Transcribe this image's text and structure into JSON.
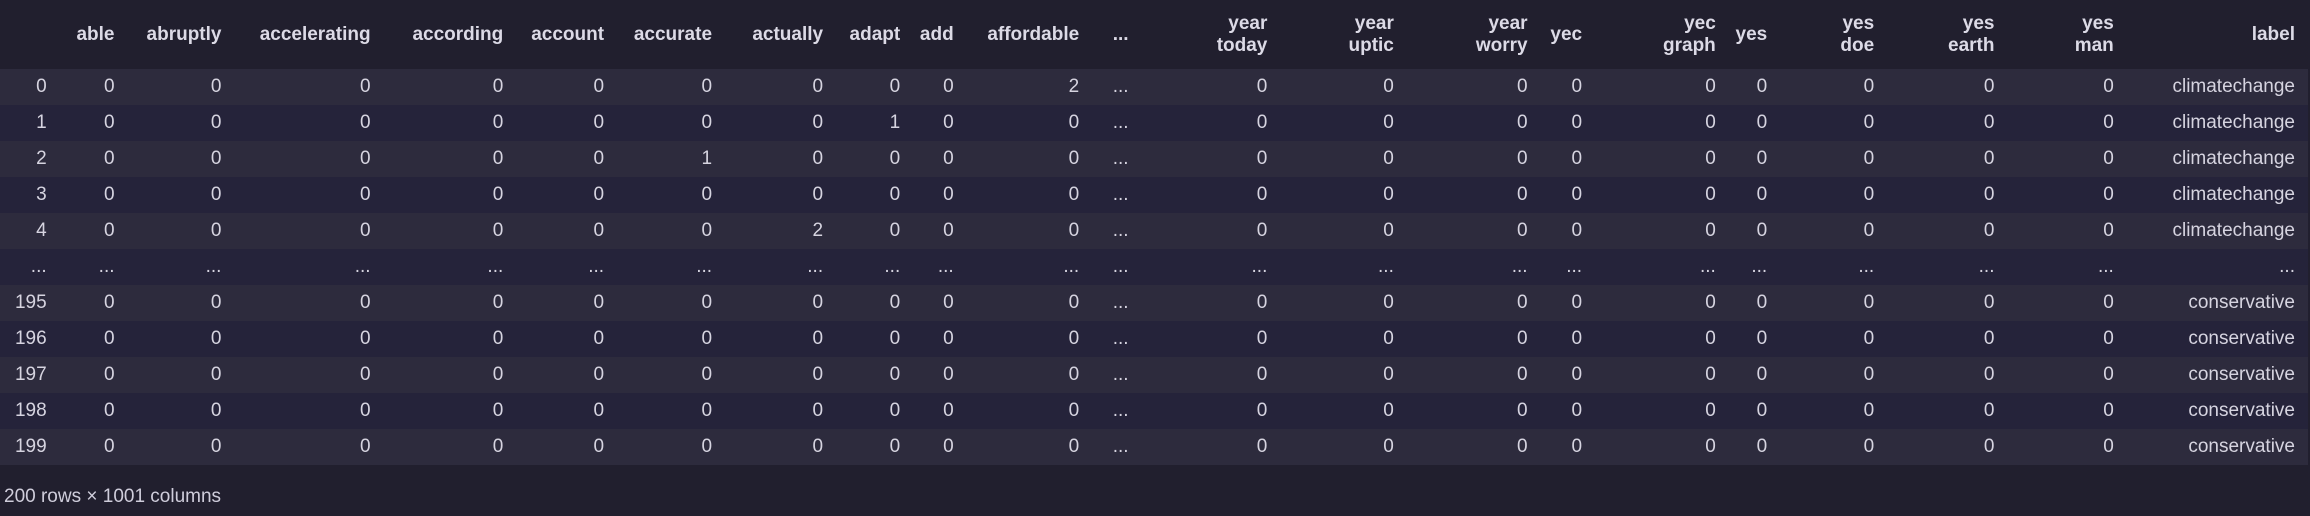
{
  "table": {
    "columns": [
      "",
      "able",
      "abruptly",
      "accelerating",
      "according",
      "account",
      "accurate",
      "actually",
      "adapt",
      "add",
      "affordable",
      "...",
      "year\ntoday",
      "year\nuptic",
      "year\nworry",
      "yec",
      "yec\ngraph",
      "yes",
      "yes\ndoe",
      "yes\nearth",
      "yes\nman",
      "label"
    ],
    "rows": [
      [
        "0",
        "0",
        "0",
        "0",
        "0",
        "0",
        "0",
        "0",
        "0",
        "0",
        "2",
        "...",
        "0",
        "0",
        "0",
        "0",
        "0",
        "0",
        "0",
        "0",
        "0",
        "climatechange"
      ],
      [
        "1",
        "0",
        "0",
        "0",
        "0",
        "0",
        "0",
        "0",
        "1",
        "0",
        "0",
        "...",
        "0",
        "0",
        "0",
        "0",
        "0",
        "0",
        "0",
        "0",
        "0",
        "climatechange"
      ],
      [
        "2",
        "0",
        "0",
        "0",
        "0",
        "0",
        "1",
        "0",
        "0",
        "0",
        "0",
        "...",
        "0",
        "0",
        "0",
        "0",
        "0",
        "0",
        "0",
        "0",
        "0",
        "climatechange"
      ],
      [
        "3",
        "0",
        "0",
        "0",
        "0",
        "0",
        "0",
        "0",
        "0",
        "0",
        "0",
        "...",
        "0",
        "0",
        "0",
        "0",
        "0",
        "0",
        "0",
        "0",
        "0",
        "climatechange"
      ],
      [
        "4",
        "0",
        "0",
        "0",
        "0",
        "0",
        "0",
        "2",
        "0",
        "0",
        "0",
        "...",
        "0",
        "0",
        "0",
        "0",
        "0",
        "0",
        "0",
        "0",
        "0",
        "climatechange"
      ],
      [
        "...",
        "...",
        "...",
        "...",
        "...",
        "...",
        "...",
        "...",
        "...",
        "...",
        "...",
        "...",
        "...",
        "...",
        "...",
        "...",
        "...",
        "...",
        "...",
        "...",
        "...",
        "..."
      ],
      [
        "195",
        "0",
        "0",
        "0",
        "0",
        "0",
        "0",
        "0",
        "0",
        "0",
        "0",
        "...",
        "0",
        "0",
        "0",
        "0",
        "0",
        "0",
        "0",
        "0",
        "0",
        "conservative"
      ],
      [
        "196",
        "0",
        "0",
        "0",
        "0",
        "0",
        "0",
        "0",
        "0",
        "0",
        "0",
        "...",
        "0",
        "0",
        "0",
        "0",
        "0",
        "0",
        "0",
        "0",
        "0",
        "conservative"
      ],
      [
        "197",
        "0",
        "0",
        "0",
        "0",
        "0",
        "0",
        "0",
        "0",
        "0",
        "0",
        "...",
        "0",
        "0",
        "0",
        "0",
        "0",
        "0",
        "0",
        "0",
        "0",
        "conservative"
      ],
      [
        "198",
        "0",
        "0",
        "0",
        "0",
        "0",
        "0",
        "0",
        "0",
        "0",
        "0",
        "...",
        "0",
        "0",
        "0",
        "0",
        "0",
        "0",
        "0",
        "0",
        "0",
        "conservative"
      ],
      [
        "199",
        "0",
        "0",
        "0",
        "0",
        "0",
        "0",
        "0",
        "0",
        "0",
        "0",
        "...",
        "0",
        "0",
        "0",
        "0",
        "0",
        "0",
        "0",
        "0",
        "0",
        "conservative"
      ]
    ]
  },
  "footer": {
    "shape_text": "200 rows × 1001 columns"
  }
}
